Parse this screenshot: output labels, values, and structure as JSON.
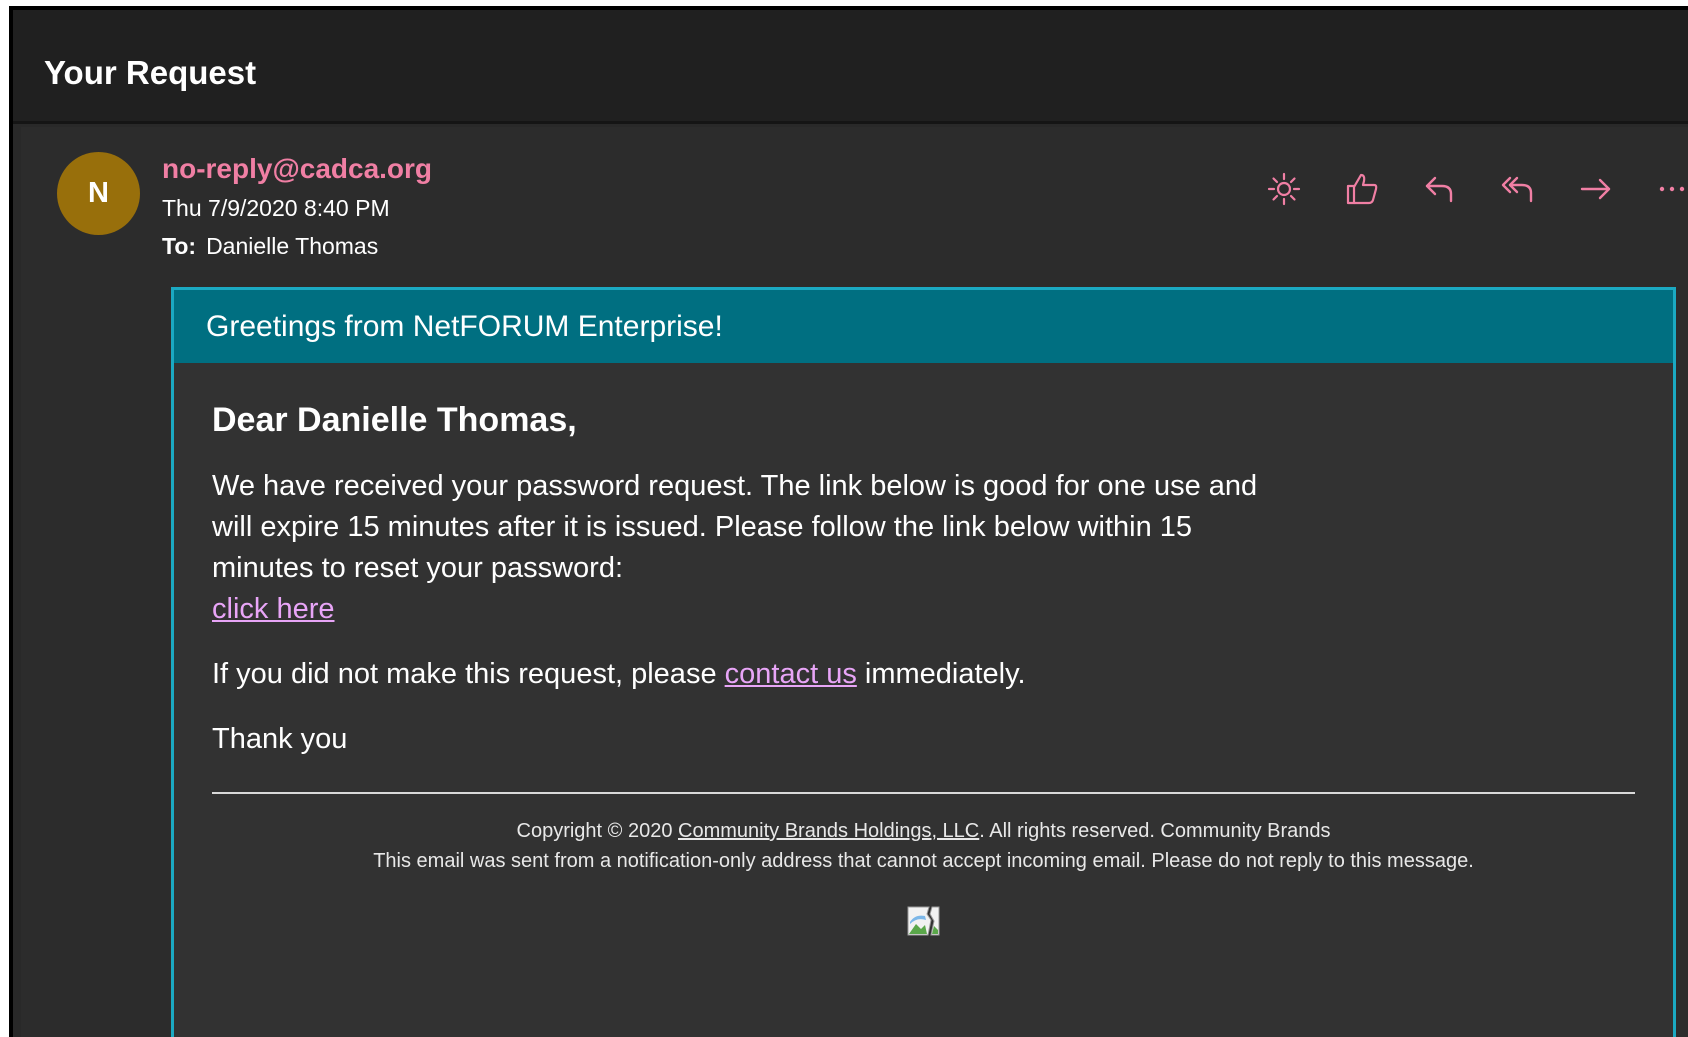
{
  "subject": "Your Request",
  "message": {
    "avatar_initial": "N",
    "sender": "no-reply@cadca.org",
    "date": "Thu 7/9/2020 8:40 PM",
    "to_label": "To:",
    "to_name": "Danielle Thomas",
    "actions": [
      {
        "name": "sun-icon"
      },
      {
        "name": "thumbs-up-icon"
      },
      {
        "name": "reply-icon"
      },
      {
        "name": "reply-all-icon"
      },
      {
        "name": "forward-icon"
      },
      {
        "name": "more-icon"
      }
    ]
  },
  "email": {
    "banner": "Greetings from NetFORUM Enterprise!",
    "greeting": "Dear Danielle Thomas,",
    "body_text": "We have received your password request. The link below is good for one use and will expire 15 minutes after it is issued. Please follow the link below within 15 minutes to reset your password:",
    "reset_link": "click here",
    "contact_prefix": "If you did not make this request, please ",
    "contact_link": "contact us",
    "contact_suffix": " immediately.",
    "thanks": "Thank you",
    "footer": {
      "copyright_prefix": "Copyright © 2020 ",
      "company_link": "Community Brands Holdings, LLC",
      "copyright_suffix": ". All rights reserved. Community Brands",
      "notice": "This email was sent from a notification-only address that cannot accept incoming email. Please do not reply to this message."
    }
  },
  "colors": {
    "accent_pink": "#f07fa4",
    "avatar": "#986f0b",
    "banner": "#006f81",
    "card_border": "#1ba9c2",
    "link": "#e8a5f7"
  }
}
